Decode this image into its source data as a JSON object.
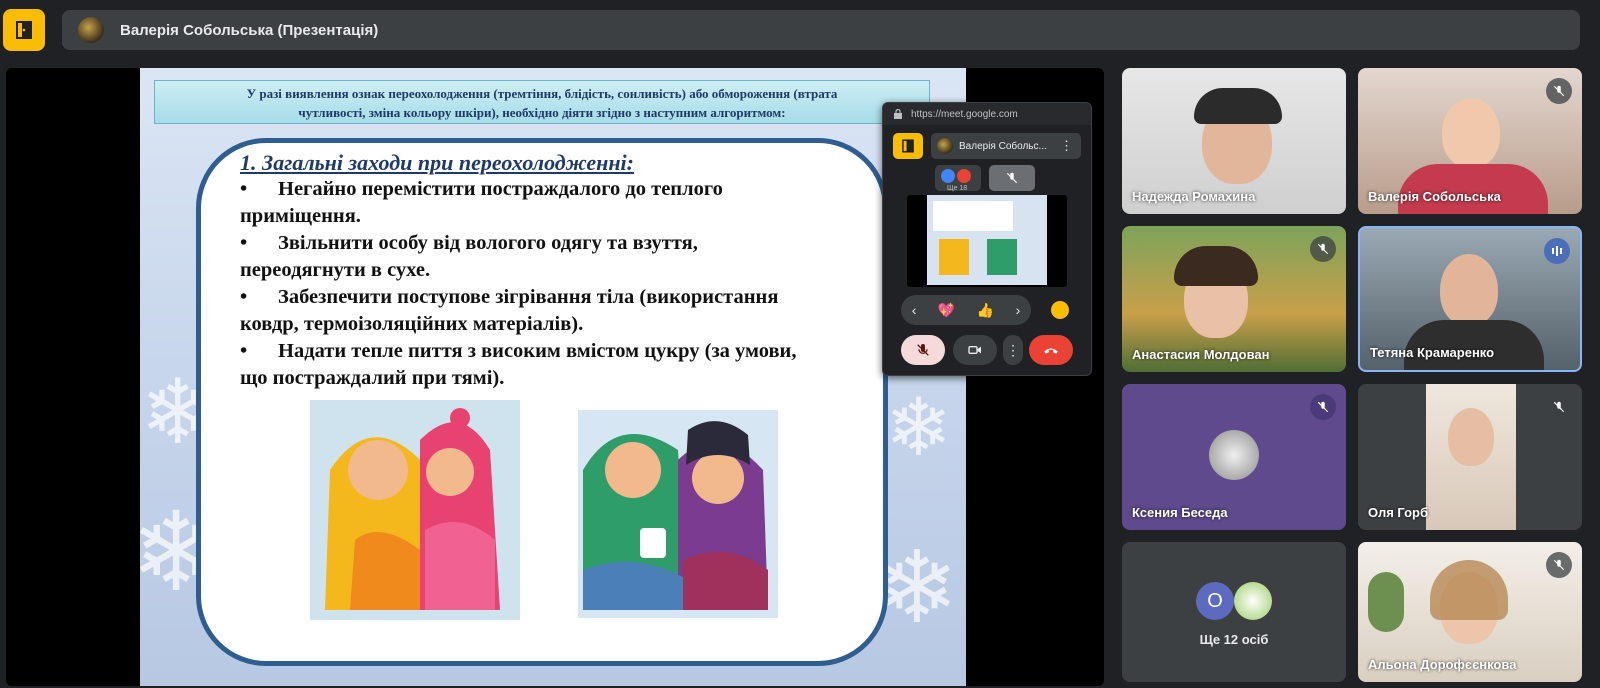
{
  "header": {
    "title": "Валерія Собольська (Презентація)"
  },
  "slide": {
    "header_line1": "У разі виявлення ознак переохолодження (тремтіння, блідість, сонливість) або обмороження (втрата",
    "header_line2": "чутливості, зміна кольору шкіри), необхідно діяти згідно з наступним алгоритмом:",
    "heading": "1. Загальні заходи при переохолодженні:",
    "bullet_symbol": "•",
    "bullets": [
      {
        "line1": "Негайно перемістити постраждалого до теплого",
        "line2": "приміщення."
      },
      {
        "line1": "Звільнити особу від вологого одягу та взуття,",
        "line2": "переодягнути в сухе."
      },
      {
        "line1": "Забезпечити поступове зігрівання тіла (використання",
        "line2": "ковдр, термоізоляційних матеріалів)."
      },
      {
        "line1": "Надати тепле пиття з високим вмістом цукру (за умови,",
        "line2": "що постраждалий при тямі)."
      }
    ]
  },
  "mini_window": {
    "url": "https://meet.google.com",
    "presenter": "Валерія Собольс...",
    "thumb_label": "Ще 18",
    "reactions": [
      "💖",
      "👍"
    ],
    "nav_prev": "‹",
    "nav_next": "›",
    "more": "⋮"
  },
  "participants": [
    {
      "name": "Надежда Ромахина",
      "muted": false
    },
    {
      "name": "Валерія Собольська",
      "muted": true
    },
    {
      "name": "Анастасия Молдован",
      "muted": true
    },
    {
      "name": "Тетяна Крамаренко",
      "muted": false,
      "speaking": true
    },
    {
      "name": "Ксения Беседа",
      "muted": true
    },
    {
      "name": "Оля Горб",
      "muted": true
    },
    {
      "name": "Альона Дорофєєнкова",
      "muted": true
    }
  ],
  "others": {
    "initial": "О",
    "label": "Ще 12 осіб"
  },
  "colors": {
    "accent_yellow": "#fbbc04",
    "end_call_red": "#ea4335",
    "background": "#202124",
    "tile_purple": "#5e4a8c"
  },
  "icons": [
    "home-icon",
    "mic-off-icon",
    "camera-icon",
    "more-vert-icon",
    "end-call-icon",
    "speaking-icon",
    "lock-icon"
  ]
}
